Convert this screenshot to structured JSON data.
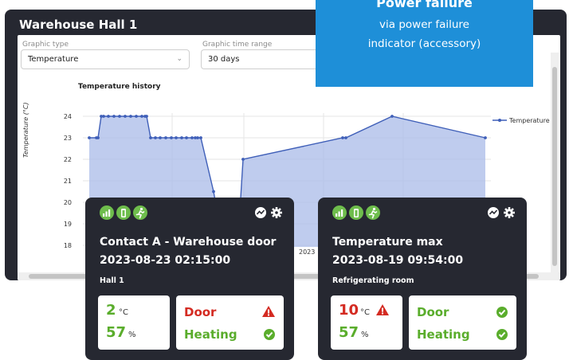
{
  "window": {
    "title": "Warehouse Hall 1",
    "graphic_type_label": "Graphic type",
    "graphic_type_value": "Temperature",
    "time_range_label": "Graphic time range",
    "time_range_value": "30 days"
  },
  "banner": {
    "line1": "Power failure",
    "line2": "via power failure",
    "line3": "indicator (accessory)"
  },
  "chart_data": {
    "type": "area",
    "title": "Temperature history",
    "ylabel": "Temperature (°C)",
    "y_ticks": [
      "24",
      "23",
      "22",
      "21",
      "20",
      "19",
      "18"
    ],
    "x_tick_partial": "2023",
    "legend_label": "Temperature",
    "series_color": "#3f5fb8",
    "fill_color": "#a9bbe8",
    "y_range": [
      17.5,
      24.5
    ],
    "points_y": [
      23,
      23,
      23,
      24,
      24,
      24,
      24,
      24,
      24,
      24,
      24,
      24,
      24,
      24,
      23,
      23,
      23,
      23,
      23,
      23,
      23,
      23,
      23,
      23,
      23,
      23,
      20.5,
      17.8,
      17.8,
      22,
      23,
      23,
      24,
      23
    ]
  },
  "cards": [
    {
      "title": "Contact A - Warehouse door",
      "date": "2023-08-23  02:15:00",
      "location": "Hall 1",
      "temp_value": "2",
      "temp_unit": "°C",
      "hum_value": "57",
      "hum_unit": "%",
      "status1": "Door",
      "status2": "Heating",
      "temp_alert": false
    },
    {
      "title": "Temperature max",
      "date": "2023-08-19  09:54:00",
      "location": "Refrigerating room",
      "temp_value": "10",
      "temp_unit": "°C",
      "hum_value": "57",
      "hum_unit": "%",
      "status1": "Door",
      "status2": "Heating",
      "temp_alert": true
    }
  ],
  "colors": {
    "ok_green": "#5aad2c",
    "alert_red": "#d42b22",
    "card_bg": "#262831",
    "banner_blue": "#1e8fd8"
  }
}
